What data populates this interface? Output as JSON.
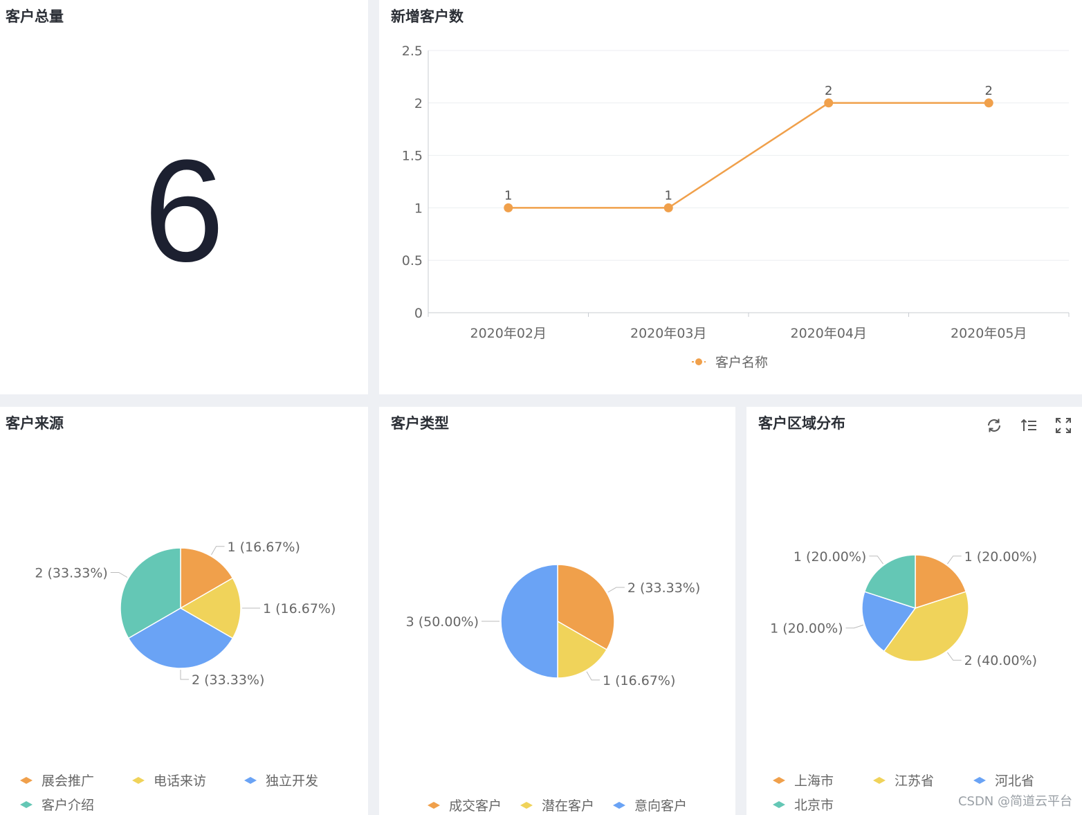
{
  "kpi_card": {
    "title": "客户总量",
    "value": "6"
  },
  "line_card": {
    "title": "新增客户数"
  },
  "source_card": {
    "title": "客户来源"
  },
  "type_card": {
    "title": "客户类型"
  },
  "region_card": {
    "title": "客户区域分布",
    "toolbar_icons": [
      "refresh-icon",
      "sort-icon",
      "fullscreen-icon"
    ]
  },
  "watermark": "CSDN @简道云平台",
  "colors": {
    "orange": "#f0a04b",
    "yellow": "#f0d35a",
    "blue": "#6aa3f5",
    "teal": "#64c7b5"
  },
  "chart_data": [
    {
      "type": "line",
      "title": "新增客户数",
      "categories": [
        "2020年02月",
        "2020年03月",
        "2020年04月",
        "2020年05月"
      ],
      "series": [
        {
          "name": "客户名称",
          "values": [
            1,
            1,
            2,
            2
          ],
          "data_labels": [
            "1",
            "1",
            "2",
            "2"
          ]
        }
      ],
      "yticks": [
        "0",
        "0.5",
        "1",
        "1.5",
        "2",
        "2.5"
      ],
      "ylim": [
        0,
        2.5
      ],
      "grid": true,
      "legend": "bottom"
    },
    {
      "type": "pie",
      "title": "客户来源",
      "slices": [
        {
          "name": "展会推广",
          "value": 1,
          "label": "1 (16.67%)"
        },
        {
          "name": "电话来访",
          "value": 1,
          "label": "1 (16.67%)"
        },
        {
          "name": "独立开发",
          "value": 2,
          "label": "2 (33.33%)"
        },
        {
          "name": "客户介绍",
          "value": 2,
          "label": "2 (33.33%)"
        }
      ],
      "legend": "bottom"
    },
    {
      "type": "pie",
      "title": "客户类型",
      "slices": [
        {
          "name": "成交客户",
          "value": 2,
          "label": "2 (33.33%)"
        },
        {
          "name": "潜在客户",
          "value": 1,
          "label": "1 (16.67%)"
        },
        {
          "name": "意向客户",
          "value": 3,
          "label": "3 (50.00%)"
        }
      ],
      "legend": "bottom"
    },
    {
      "type": "pie",
      "title": "客户区域分布",
      "slices": [
        {
          "name": "上海市",
          "value": 1,
          "label": "1 (20.00%)"
        },
        {
          "name": "江苏省",
          "value": 2,
          "label": "2 (40.00%)"
        },
        {
          "name": "河北省",
          "value": 1,
          "label": "1 (20.00%)"
        },
        {
          "name": "北京市",
          "value": 1,
          "label": "1 (20.00%)"
        }
      ],
      "legend": "bottom"
    }
  ]
}
